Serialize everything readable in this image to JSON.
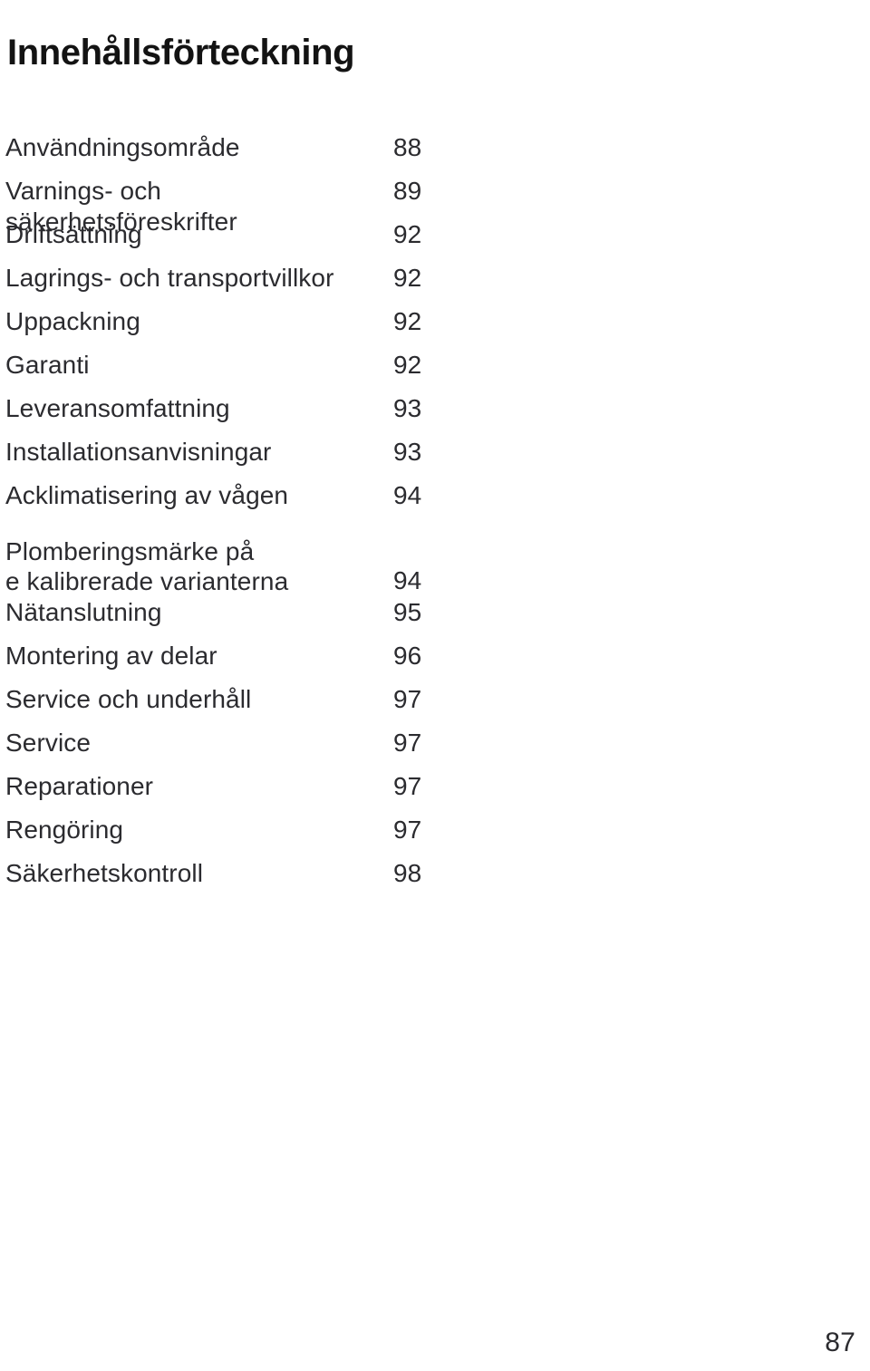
{
  "document": {
    "title": "Innehållsförteckning",
    "language": "sv",
    "folio": "87",
    "text_color": "#2b2b2f",
    "title_color": "#131313",
    "background_color": "#ffffff"
  },
  "toc": {
    "entries": [
      {
        "label": "Användningsområde",
        "page": "88",
        "lines": 1
      },
      {
        "label": "Varnings- och säkerhetsföreskrifter",
        "page": "89",
        "lines": 1
      },
      {
        "label": "Driftsättning",
        "page": "92",
        "lines": 1
      },
      {
        "label": "Lagrings- och transportvillkor",
        "page": "92",
        "lines": 1
      },
      {
        "label": "Uppackning",
        "page": "92",
        "lines": 1
      },
      {
        "label": "Garanti",
        "page": "92",
        "lines": 1
      },
      {
        "label": "Leveransomfattning",
        "page": "93",
        "lines": 1
      },
      {
        "label": "Installationsanvisningar",
        "page": "93",
        "lines": 1
      },
      {
        "label": "Acklimatisering av vågen",
        "page": "94",
        "lines": 1
      },
      {
        "label": "Plomberingsmärke på\ne kalibrerade varianterna",
        "page": "94",
        "lines": 2
      },
      {
        "label": "Nätanslutning",
        "page": "95",
        "lines": 1
      },
      {
        "label": "Montering av delar",
        "page": "96",
        "lines": 1
      },
      {
        "label": "Service och underhåll",
        "page": "97",
        "lines": 1
      },
      {
        "label": "Service",
        "page": "97",
        "lines": 1
      },
      {
        "label": "Reparationer",
        "page": "97",
        "lines": 1
      },
      {
        "label": "Rengöring",
        "page": "97",
        "lines": 1
      },
      {
        "label": "Säkerhetskontroll",
        "page": "98",
        "lines": 1
      }
    ]
  }
}
